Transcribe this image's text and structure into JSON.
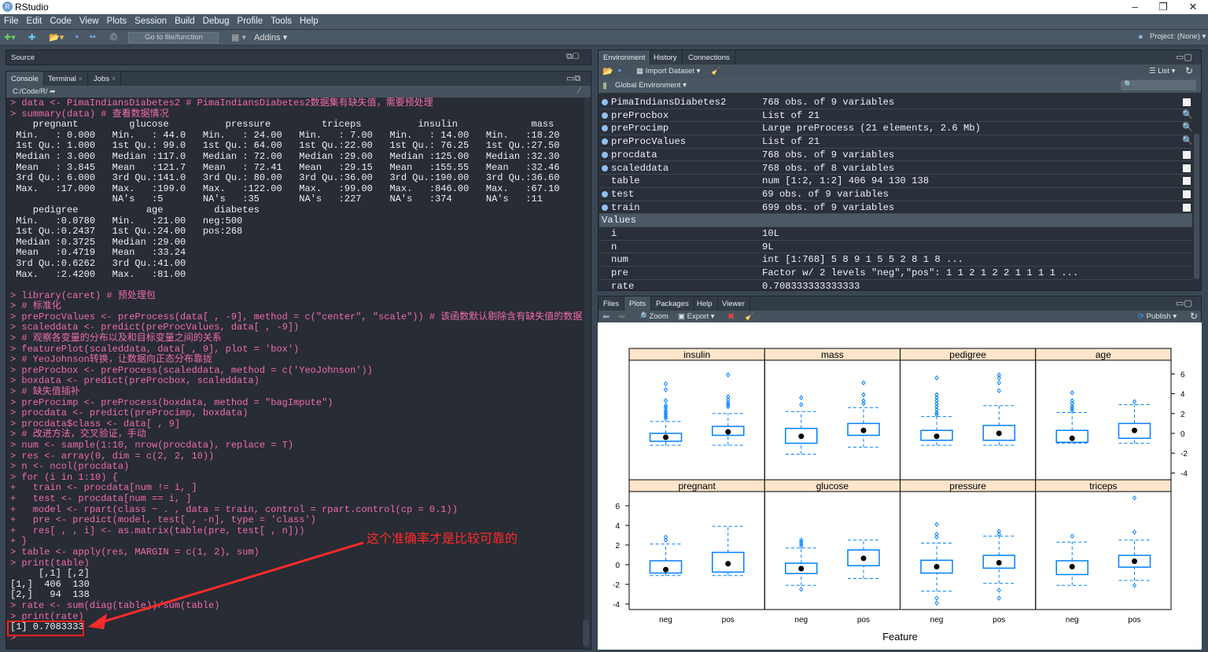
{
  "window": {
    "title": "RStudio",
    "logo": "R"
  },
  "menu": [
    "File",
    "Edit",
    "Code",
    "View",
    "Plots",
    "Session",
    "Build",
    "Debug",
    "Profile",
    "Tools",
    "Help"
  ],
  "toolbar": {
    "goto": "Go to file/function",
    "addins": "Addins",
    "project": "Project: (None)"
  },
  "source": {
    "title": "Source"
  },
  "console_tabs": [
    "Console",
    "Terminal",
    "Jobs"
  ],
  "console_path": "C:/Code/R/",
  "console_lines": [
    {
      "c": "cmd",
      "t": "> data <- PimaIndiansDiabetes2 # PimaIndiansDiabetes2数据集有缺失值，需要预处理"
    },
    {
      "c": "cmd",
      "t": "> summary(data) # 查看数据情况"
    },
    {
      "c": "out",
      "t": "    pregnant         glucose          pressure         triceps          insulin             mass     "
    },
    {
      "c": "out",
      "t": " Min.   : 0.000   Min.   : 44.0   Min.   : 24.00   Min.   : 7.00   Min.   : 14.00   Min.   :18.20  "
    },
    {
      "c": "out",
      "t": " 1st Qu.: 1.000   1st Qu.: 99.0   1st Qu.: 64.00   1st Qu.:22.00   1st Qu.: 76.25   1st Qu.:27.50  "
    },
    {
      "c": "out",
      "t": " Median : 3.000   Median :117.0   Median : 72.00   Median :29.00   Median :125.00   Median :32.30  "
    },
    {
      "c": "out",
      "t": " Mean   : 3.845   Mean   :121.7   Mean   : 72.41   Mean   :29.15   Mean   :155.55   Mean   :32.46  "
    },
    {
      "c": "out",
      "t": " 3rd Qu.: 6.000   3rd Qu.:141.0   3rd Qu.: 80.00   3rd Qu.:36.00   3rd Qu.:190.00   3rd Qu.:36.60  "
    },
    {
      "c": "out",
      "t": " Max.   :17.000   Max.   :199.0   Max.   :122.00   Max.   :99.00   Max.   :846.00   Max.   :67.10  "
    },
    {
      "c": "out",
      "t": "                  NA's   :5       NA's   :35       NA's   :227     NA's   :374      NA's   :11     "
    },
    {
      "c": "out",
      "t": "    pedigree            age         diabetes "
    },
    {
      "c": "out",
      "t": " Min.   :0.0780   Min.   :21.00   neg:500  "
    },
    {
      "c": "out",
      "t": " 1st Qu.:0.2437   1st Qu.:24.00   pos:268  "
    },
    {
      "c": "out",
      "t": " Median :0.3725   Median :29.00            "
    },
    {
      "c": "out",
      "t": " Mean   :0.4719   Mean   :33.24            "
    },
    {
      "c": "out",
      "t": " 3rd Qu.:0.6262   3rd Qu.:41.00            "
    },
    {
      "c": "out",
      "t": " Max.   :2.4200   Max.   :81.00            "
    },
    {
      "c": "out",
      "t": " "
    },
    {
      "c": "cmd",
      "t": "> library(caret) # 预处理包"
    },
    {
      "c": "cmd",
      "t": "> # 标准化"
    },
    {
      "c": "cmd",
      "t": "> preProcValues <- preProcess(data[ , -9], method = c(\"center\", \"scale\")) # 该函数默认剔除含有缺失值的数据"
    },
    {
      "c": "cmd",
      "t": "> scaleddata <- predict(preProcValues, data[ , -9])"
    },
    {
      "c": "cmd",
      "t": "> # 观察各变量的分布以及和目标变量之间的关系"
    },
    {
      "c": "cmd",
      "t": "> featurePlot(scaleddata, data[ , 9], plot = 'box')"
    },
    {
      "c": "cmd",
      "t": "> # YeoJohnson转换，让数据向正态分布靠拢"
    },
    {
      "c": "cmd",
      "t": "> preProcbox <- preProcess(scaleddata, method = c('YeoJohnson'))"
    },
    {
      "c": "cmd",
      "t": "> boxdata <- predict(preProcbox, scaleddata)"
    },
    {
      "c": "cmd",
      "t": "> # 缺失值插补"
    },
    {
      "c": "cmd",
      "t": "> preProcimp <- preProcess(boxdata, method = \"bagImpute\")"
    },
    {
      "c": "cmd",
      "t": "> procdata <- predict(preProcimp, boxdata)"
    },
    {
      "c": "cmd",
      "t": "> procdata$class <- data[ , 9]"
    },
    {
      "c": "cmd",
      "t": "> # 改进方法，交叉验证，手动"
    },
    {
      "c": "cmd",
      "t": "> num <- sample(1:10, nrow(procdata), replace = T)"
    },
    {
      "c": "cmd",
      "t": "> res <- array(0, dim = c(2, 2, 10))"
    },
    {
      "c": "cmd",
      "t": "> n <- ncol(procdata)"
    },
    {
      "c": "cmd",
      "t": "> for (i in 1:10) {"
    },
    {
      "c": "cmd",
      "t": "+   train <- procdata[num != i, ]"
    },
    {
      "c": "cmd",
      "t": "+   test <- procdata[num == i, ]"
    },
    {
      "c": "cmd",
      "t": "+   model <- rpart(class ~ . , data = train, control = rpart.control(cp = 0.1))"
    },
    {
      "c": "cmd",
      "t": "+   pre <- predict(model, test[ , -n], type = 'class')"
    },
    {
      "c": "cmd",
      "t": "+   res[ , , i] <- as.matrix(table(pre, test[ , n]))"
    },
    {
      "c": "cmd",
      "t": "+ }"
    },
    {
      "c": "cmd",
      "t": "> table <- apply(res, MARGIN = c(1, 2), sum)"
    },
    {
      "c": "cmd",
      "t": "> print(table)"
    },
    {
      "c": "out",
      "t": "     [,1] [,2]"
    },
    {
      "c": "out",
      "t": "[1,]  406  130"
    },
    {
      "c": "out",
      "t": "[2,]   94  138"
    },
    {
      "c": "cmd",
      "t": "> rate <- sum(diag(table))/sum(table)"
    },
    {
      "c": "cmd",
      "t": "> print(rate)"
    },
    {
      "c": "out",
      "t": "[1] 0.7083333"
    },
    {
      "c": "cmd",
      "t": "> "
    }
  ],
  "annotation": {
    "text": "这个准确率才是比较可靠的",
    "color": "#ff2a2a"
  },
  "env": {
    "tabs": [
      "Environment",
      "History",
      "Connections"
    ],
    "import_dataset": "Import Dataset",
    "list_view": "List",
    "scope": "Global Environment",
    "data_rows": [
      {
        "name": "PimaIndiansDiabetes2",
        "value": "768 obs. of 9 variables",
        "icon": "grid"
      },
      {
        "name": "preProcbox",
        "value": "List of 21",
        "icon": "search"
      },
      {
        "name": "preProcimp",
        "value": "Large preProcess (21 elements, 2.6 Mb)",
        "icon": "search"
      },
      {
        "name": "preProcValues",
        "value": "List of 21",
        "icon": "search"
      },
      {
        "name": "procdata",
        "value": "768 obs. of 9 variables",
        "icon": "grid"
      },
      {
        "name": "scaleddata",
        "value": "768 obs. of 8 variables",
        "icon": "grid"
      },
      {
        "name": "table",
        "value": "num [1:2, 1:2] 406 94 130 138",
        "icon": "grid",
        "nodot": true
      },
      {
        "name": "test",
        "value": "69 obs. of 9 variables",
        "icon": "grid"
      },
      {
        "name": "train",
        "value": "699 obs. of 9 variables",
        "icon": "grid"
      }
    ],
    "values_header": "Values",
    "value_rows": [
      {
        "name": "i",
        "value": "10L"
      },
      {
        "name": "n",
        "value": "9L"
      },
      {
        "name": "num",
        "value": "int [1:768] 5 8 9 1 5 5 2 8 1 8 ..."
      },
      {
        "name": "pre",
        "value": "Factor w/ 2 levels \"neg\",\"pos\": 1 1 2 1 2 2 1 1 1 1 ..."
      },
      {
        "name": "rate",
        "value": "0.708333333333333"
      }
    ]
  },
  "files": {
    "tabs": [
      "Files",
      "Plots",
      "Packages",
      "Help",
      "Viewer"
    ],
    "zoom": "Zoom",
    "export": "Export",
    "publish": "Publish"
  },
  "chart_data": {
    "type": "box",
    "xlabel": "Feature",
    "ylabel": "",
    "ylim": [
      -4.5,
      7
    ],
    "yticks": [
      -4,
      -2,
      0,
      2,
      4,
      6
    ],
    "groups": [
      "neg",
      "pos"
    ],
    "panels": [
      {
        "name": "pregnant",
        "row": "bottom",
        "boxes": [
          {
            "stats": [
              -1.1,
              -0.85,
              -0.5,
              0.4,
              2.1
            ],
            "out": [
              2.5,
              2.8
            ]
          },
          {
            "stats": [
              -1.1,
              -0.75,
              0.1,
              1.25,
              3.9
            ],
            "out": []
          }
        ]
      },
      {
        "name": "glucose",
        "row": "bottom",
        "boxes": [
          {
            "stats": [
              -2.1,
              -0.9,
              -0.4,
              0.15,
              1.7
            ],
            "out": [
              -2.5,
              1.9,
              2.1,
              2.3,
              2.5
            ]
          },
          {
            "stats": [
              -1.4,
              -0.1,
              0.65,
              1.5,
              2.5
            ],
            "out": []
          }
        ]
      },
      {
        "name": "pressure",
        "row": "bottom",
        "boxes": [
          {
            "stats": [
              -2.7,
              -0.85,
              -0.2,
              0.45,
              2.2
            ],
            "out": [
              -3.9,
              -3.4,
              2.8,
              3.1,
              4.1
            ]
          },
          {
            "stats": [
              -1.9,
              -0.35,
              0.2,
              0.95,
              2.9
            ],
            "out": [
              -3.4,
              -2.6,
              3.1,
              3.4
            ]
          }
        ]
      },
      {
        "name": "triceps",
        "row": "bottom",
        "boxes": [
          {
            "stats": [
              -2.1,
              -1.0,
              -0.2,
              0.4,
              2.3
            ],
            "out": [
              2.9
            ]
          },
          {
            "stats": [
              -1.6,
              -0.25,
              0.35,
              0.95,
              2.5
            ],
            "out": [
              -2.1,
              3.3,
              6.8
            ]
          }
        ]
      },
      {
        "name": "insulin",
        "row": "top",
        "boxes": [
          {
            "stats": [
              -1.2,
              -0.8,
              -0.4,
              0.0,
              1.2
            ],
            "out": [
              1.5,
              1.7,
              1.9,
              2.1,
              2.3,
              2.6,
              2.8,
              3.3,
              4.4,
              5.0
            ]
          },
          {
            "stats": [
              -1.2,
              -0.2,
              0.15,
              0.7,
              2.0
            ],
            "out": [
              2.7,
              2.9,
              3.1,
              3.4,
              3.7,
              5.9
            ]
          }
        ]
      },
      {
        "name": "mass",
        "row": "top",
        "boxes": [
          {
            "stats": [
              -2.1,
              -1.0,
              -0.3,
              0.5,
              2.2
            ],
            "out": [
              2.9,
              3.6
            ]
          },
          {
            "stats": [
              -1.4,
              -0.2,
              0.3,
              1.0,
              2.6
            ],
            "out": [
              3.0,
              3.3,
              3.9,
              5.1
            ]
          }
        ]
      },
      {
        "name": "pedigree",
        "row": "top",
        "boxes": [
          {
            "stats": [
              -1.2,
              -0.7,
              -0.3,
              0.3,
              1.7
            ],
            "out": [
              1.9,
              2.1,
              2.4,
              2.7,
              3.0,
              3.3,
              3.6,
              3.9,
              5.6
            ]
          },
          {
            "stats": [
              -1.2,
              -0.7,
              0.0,
              0.8,
              2.8
            ],
            "out": [
              4.3,
              5.1,
              5.6,
              5.9
            ]
          }
        ]
      },
      {
        "name": "age",
        "row": "top",
        "boxes": [
          {
            "stats": [
              -1.0,
              -0.9,
              -0.5,
              0.3,
              2.1
            ],
            "out": [
              2.3,
              2.5,
              2.7,
              3.0,
              3.3,
              4.1
            ]
          },
          {
            "stats": [
              -1.0,
              -0.5,
              0.3,
              1.0,
              2.9
            ],
            "out": [
              3.2
            ]
          }
        ]
      }
    ],
    "colors": {
      "box": "#0080ff",
      "strip": "#ffe5cc",
      "median": "#000000"
    }
  }
}
